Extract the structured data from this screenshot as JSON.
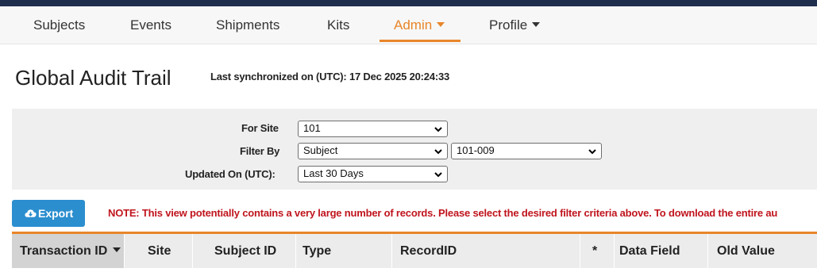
{
  "nav": {
    "items": [
      {
        "label": "Subjects"
      },
      {
        "label": "Events"
      },
      {
        "label": "Shipments"
      },
      {
        "label": "Kits"
      },
      {
        "label": "Admin"
      },
      {
        "label": "Profile"
      }
    ],
    "active": "Admin",
    "accent_color": "#e8862a"
  },
  "header": {
    "title": "Global Audit Trail",
    "sync_text": "Last synchronized on (UTC): 17 Dec 2025 20:24:33"
  },
  "filters": {
    "site_label": "For Site",
    "site_value": "101",
    "filter_by_label": "Filter By",
    "filter_by_value": "Subject",
    "filter_subject_value": "101-009",
    "updated_on_label": "Updated On (UTC):",
    "updated_on_value": "Last 30 Days"
  },
  "actions": {
    "export_label": "Export",
    "export_icon": "cloud-download-icon",
    "button_color": "#2b8ecf"
  },
  "note": "NOTE: This view potentially contains a very large number of records. Please select the desired filter criteria above. To download the entire au",
  "table": {
    "columns": [
      {
        "label": "Transaction ID",
        "sorted": true
      },
      {
        "label": "Site"
      },
      {
        "label": "Subject ID"
      },
      {
        "label": "Type"
      },
      {
        "label": "RecordID"
      },
      {
        "label": "*"
      },
      {
        "label": "Data Field"
      },
      {
        "label": "Old Value"
      }
    ]
  }
}
